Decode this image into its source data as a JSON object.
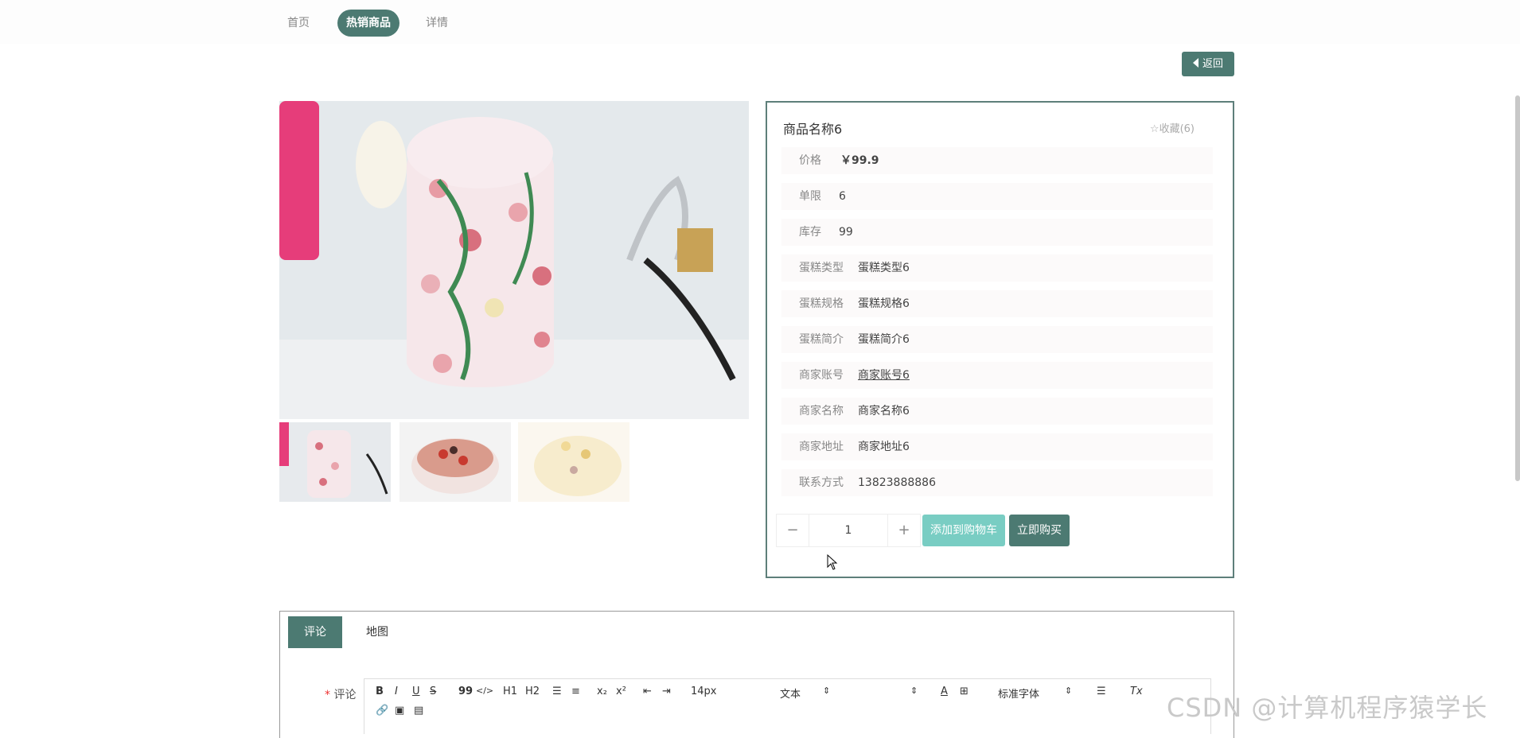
{
  "nav": {
    "home": "首页",
    "hot": "热销商品",
    "detail": "详情"
  },
  "back_label": "返回",
  "product": {
    "name": "商品名称6",
    "favorite": "收藏(6)",
    "rows": [
      {
        "label": "价格",
        "value": "￥99.9"
      },
      {
        "label": "单限",
        "value": "6"
      },
      {
        "label": "库存",
        "value": "99"
      },
      {
        "label": "蛋糕类型",
        "value": "蛋糕类型6"
      },
      {
        "label": "蛋糕规格",
        "value": "蛋糕规格6"
      },
      {
        "label": "蛋糕简介",
        "value": "蛋糕简介6"
      },
      {
        "label": "商家账号",
        "value": "商家账号6"
      },
      {
        "label": "商家名称",
        "value": "商家名称6"
      },
      {
        "label": "商家地址",
        "value": "商家地址6"
      },
      {
        "label": "联系方式",
        "value": "13823888886"
      }
    ],
    "quantity": "1",
    "add_to_cart": "添加到购物车",
    "buy_now": "立即购买"
  },
  "tabs": {
    "comment": "评论",
    "map": "地图"
  },
  "comment_field": {
    "required_mark": "*",
    "label": "评论"
  },
  "toolbar": {
    "font_size": "14px",
    "text_style": "文本",
    "font_family": "标准字体",
    "h1": "H1",
    "h2": "H2",
    "bold": "B",
    "italic": "I",
    "underline": "U",
    "strike": "S",
    "quote": "99",
    "code": "</>",
    "sub": "x₂",
    "sup": "x²"
  },
  "watermark": "CSDN @计算机程序猿学长",
  "colors": {
    "accent": "#4c7a72",
    "cart": "#79cdc3",
    "price": "#d62a1f"
  }
}
